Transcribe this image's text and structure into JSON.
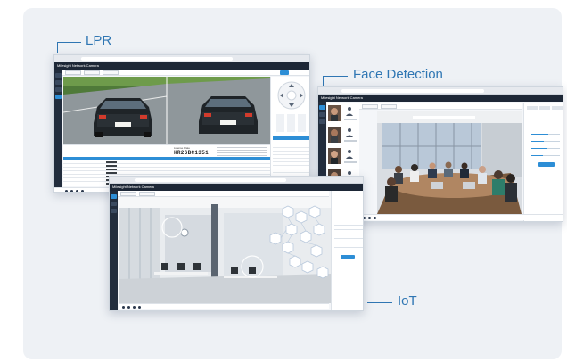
{
  "labels": {
    "lpr": "LPR",
    "face_detection": "Face Detection",
    "iot": "IoT"
  },
  "lpr_window": {
    "app_title": "Milesight Network Camera",
    "plate_caption": "License Plate",
    "plate_number": "HR26BC1351",
    "table_rows": 9
  },
  "face_window": {
    "app_title": "Milesight Network Camera",
    "face_thumbnails": 5
  },
  "iot_window": {
    "app_title": "Milesight Network Camera",
    "sensor_nodes": 12
  },
  "colors": {
    "accent": "#2d8ed6",
    "callout": "#2f76b3",
    "appbar": "#1d2736",
    "background": "#eef1f5"
  },
  "icons": [
    "camera-icon",
    "face-icon",
    "person-icon",
    "hexagon-icon",
    "play-icon",
    "settings-icon"
  ]
}
